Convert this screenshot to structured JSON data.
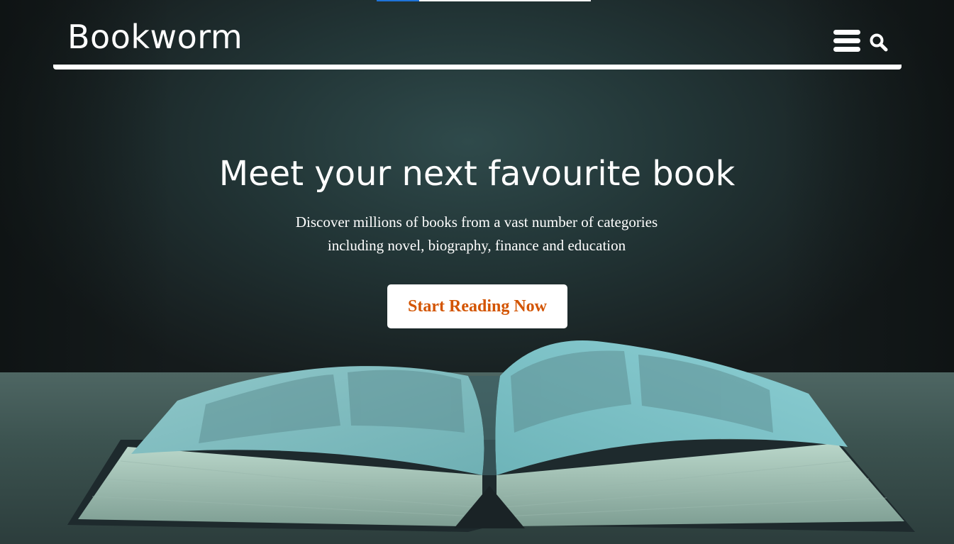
{
  "header": {
    "brand": "Bookworm",
    "menu_icon": "hamburger-menu-icon",
    "search_icon": "search-icon"
  },
  "page_load_progress": 0.2,
  "hero": {
    "headline": "Meet your next favourite book",
    "subtext_line1": "Discover millions of books from a vast number of categories",
    "subtext_line2": "including novel, biography, finance and education",
    "cta_label": "Start Reading Now",
    "background_image": "open-book-on-table"
  },
  "colors": {
    "accent": "#d35400",
    "text": "#ffffff",
    "background": "#1d2a2b",
    "progress": "#1e73d8"
  }
}
